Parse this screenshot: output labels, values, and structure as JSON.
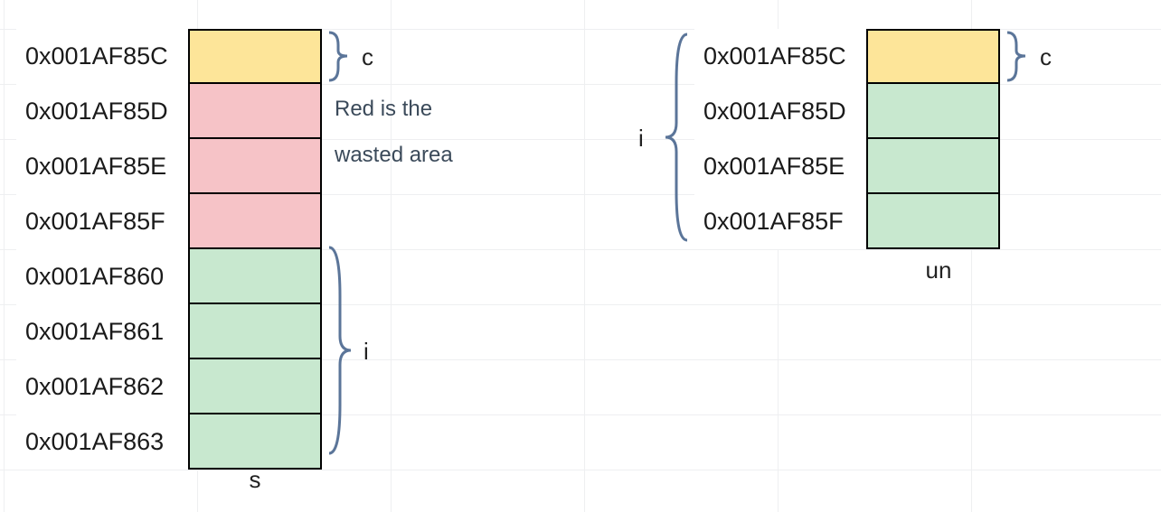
{
  "colors": {
    "yellow": "#fde599",
    "red": "#f6c3c7",
    "green": "#c8e8cf"
  },
  "left": {
    "rows": [
      {
        "addr": "0x001AF85C",
        "color": "yellow"
      },
      {
        "addr": "0x001AF85D",
        "color": "red"
      },
      {
        "addr": "0x001AF85E",
        "color": "red"
      },
      {
        "addr": "0x001AF85F",
        "color": "red"
      },
      {
        "addr": "0x001AF860",
        "color": "green"
      },
      {
        "addr": "0x001AF861",
        "color": "green"
      },
      {
        "addr": "0x001AF862",
        "color": "green"
      },
      {
        "addr": "0x001AF863",
        "color": "green"
      }
    ],
    "caption_below": "s",
    "brace_c_label": "c",
    "brace_i_label": "i",
    "note_line1": "Red is the",
    "note_line2": "wasted area"
  },
  "right": {
    "rows": [
      {
        "addr": "0x001AF85C",
        "color": "yellow"
      },
      {
        "addr": "0x001AF85D",
        "color": "green"
      },
      {
        "addr": "0x001AF85E",
        "color": "green"
      },
      {
        "addr": "0x001AF85F",
        "color": "green"
      }
    ],
    "caption_below": "un",
    "brace_c_label": "c",
    "brace_i_label": "i"
  }
}
